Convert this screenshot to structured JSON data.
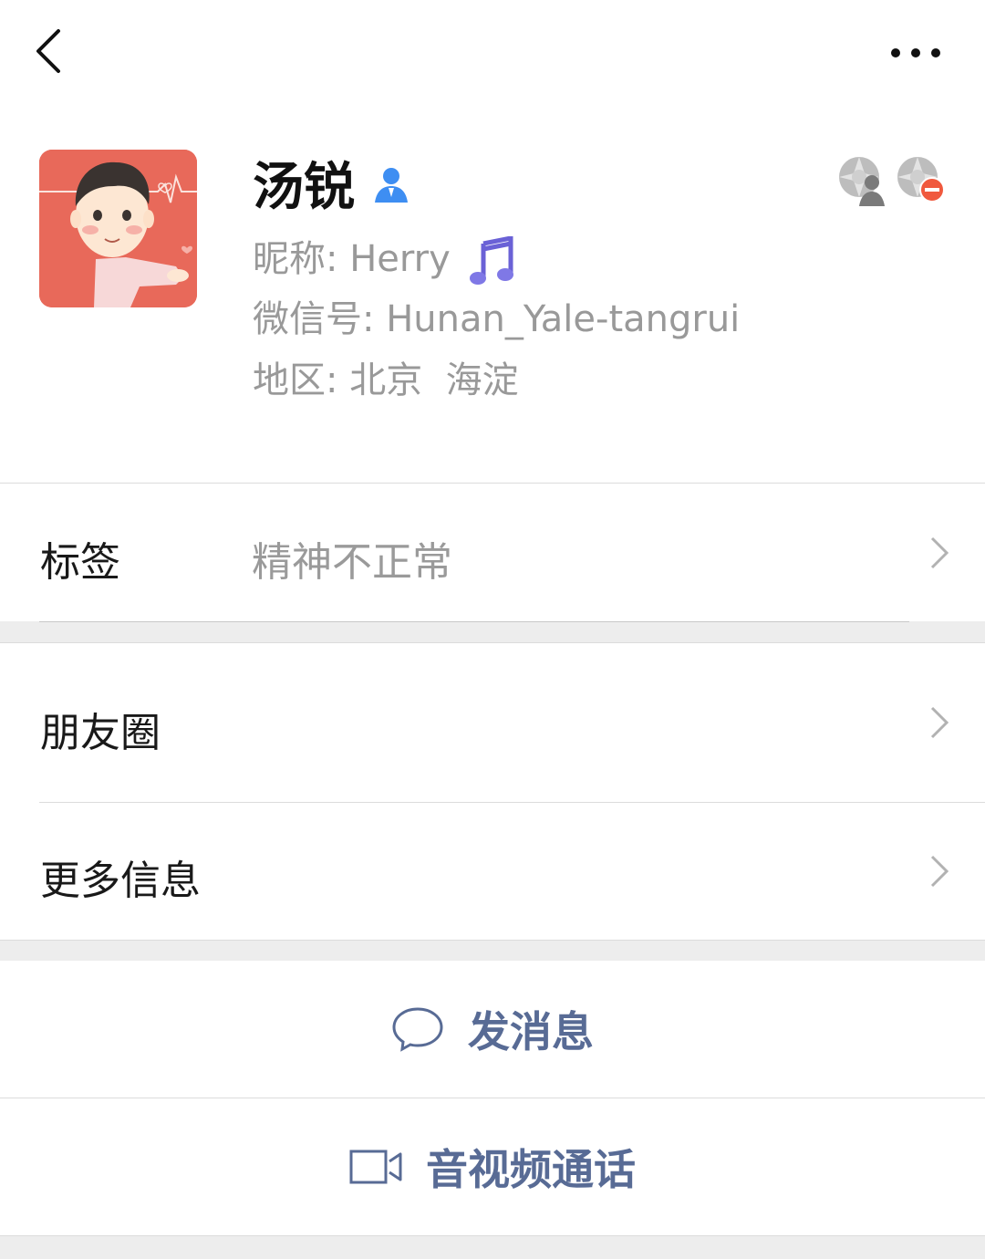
{
  "header": {
    "back_icon": "back-arrow-icon",
    "more_icon": "more-dots-icon"
  },
  "profile": {
    "name": "汤锐",
    "nickname_label": "昵称:",
    "nickname_value": "Herry",
    "wechat_id_label": "微信号:",
    "wechat_id_value": "Hunan_Yale-tangrui",
    "region_label": "地区:",
    "region_value": "北京  海淀",
    "contact_icon": "contact-person-icon",
    "music_icon": "music-note-icon",
    "social_icons": [
      "moments-contact-icon",
      "moments-blocked-icon"
    ]
  },
  "rows": {
    "tags": {
      "label": "标签",
      "value": "精神不正常"
    },
    "moments": {
      "label": "朋友圈"
    },
    "more_info": {
      "label": "更多信息"
    }
  },
  "actions": {
    "send_message": {
      "label": "发消息",
      "icon": "chat-bubble-icon"
    },
    "video_call": {
      "label": "音视频通话",
      "icon": "video-camera-icon"
    }
  },
  "colors": {
    "accent": "#586b95",
    "avatar_bg": "#e8695a",
    "badge_red": "#f0593e",
    "contact_icon_blue": "#3e8ef2"
  }
}
